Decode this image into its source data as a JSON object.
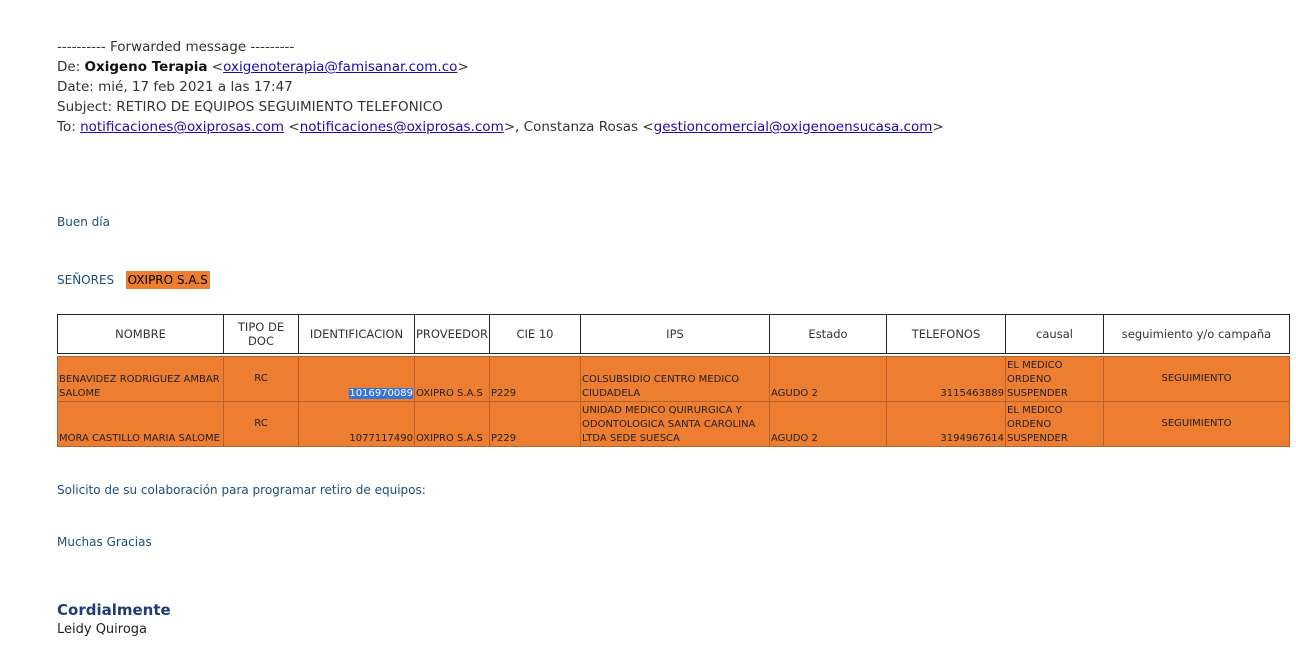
{
  "email": {
    "forward_line": "---------- Forwarded message ---------",
    "from_label": "De:",
    "from_name": "Oxigeno Terapia",
    "from_email": "oxigenoterapia@famisanar.com.co",
    "date_line": "Date: mié, 17 feb 2021 a las 17:47",
    "subject_line": "Subject: RETIRO DE EQUIPOS SEGUIMIENTO TELEFONICO",
    "to_label": "To:",
    "to_email_1": "notificaciones@oxiprosas.com",
    "to_email_2": "notificaciones@oxiprosas.com",
    "to_name_3": "Constanza Rosas",
    "to_email_3": "gestioncomercial@oxigenoensucasa.com"
  },
  "body": {
    "greeting": "Buen día",
    "senores_label": "SEÑORES",
    "senores_company": "OXIPRO S.A.S",
    "request_text": "Solicito de su colaboración para programar retiro de equipos:",
    "thanks": "Muchas Gracias",
    "closing": "Cordialmente",
    "signature_name": "Leidy Quiroga"
  },
  "table": {
    "headers": [
      "NOMBRE",
      "TIPO DE DOC",
      "IDENTIFICACION",
      "PROVEEDOR",
      "CIE 10",
      "IPS",
      "Estado",
      "TELEFONOS",
      "causal",
      "seguimiento y/o  campaña"
    ],
    "rows": [
      {
        "nombre": "BENAVIDEZ RODRIGUEZ AMBAR SALOME",
        "tipo_doc": "RC",
        "identificacion": "1016970089",
        "proveedor": "OXIPRO S.A.S",
        "cie10": "P229",
        "ips": "COLSUBSIDIO CENTRO MEDICO CIUDADELA",
        "estado": "AGUDO 2",
        "telefonos": "3115463889",
        "causal": "EL MEDICO ORDENO SUSPENDER",
        "seguimiento": "SEGUIMIENTO"
      },
      {
        "nombre": "MORA CASTILLO MARIA SALOME",
        "tipo_doc": "RC",
        "identificacion": "1077117490",
        "proveedor": "OXIPRO S.A.S",
        "cie10": "P229",
        "ips": "UNIDAD MEDICO QUIRURGICA Y ODONTOLOGICA SANTA CAROLINA LTDA SEDE SUESCA",
        "estado": "AGUDO 2",
        "telefonos": "3194967614",
        "causal": "EL MEDICO ORDENO SUSPENDER",
        "seguimiento": "SEGUIMIENTO"
      }
    ]
  },
  "colors": {
    "highlight": "#ed7d31",
    "link": "#1a0dab",
    "body_text_blue": "#1f4e79",
    "selection": "#3874d8"
  }
}
